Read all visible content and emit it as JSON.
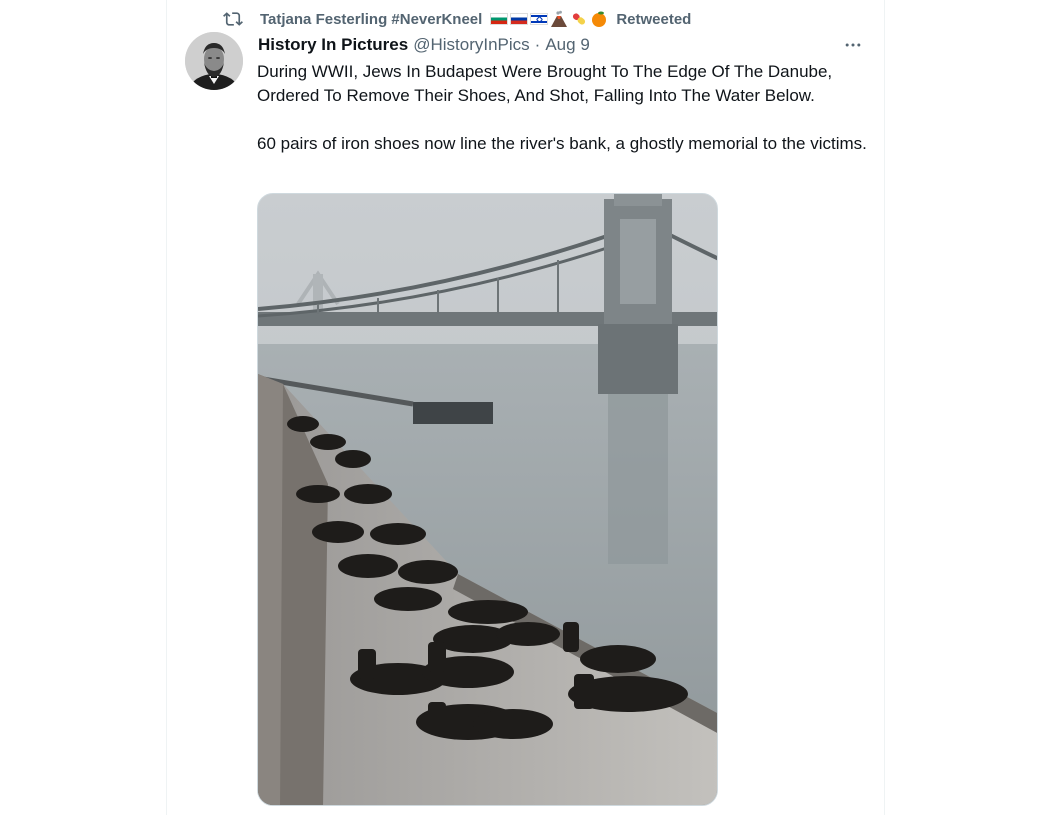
{
  "retweet": {
    "icon": "retweet-icon",
    "user": "Tatjana Festerling #NeverKneel",
    "flags": [
      "bulgaria-flag",
      "russia-flag",
      "israel-flag"
    ],
    "emojis": [
      "volcano-emoji",
      "pill-emoji",
      "orange-emoji"
    ],
    "label": "Retweeted"
  },
  "tweet": {
    "author_name": "History In Pictures",
    "handle": "@HistoryInPics",
    "separator": "·",
    "date": "Aug 9",
    "more_icon": "more-icon",
    "paragraph_1": "During WWII, Jews In Budapest Were Brought To The Edge Of The Danube, Ordered To Remove Their Shoes, And Shot, Falling Into The Water Below.",
    "paragraph_2": "60 pairs of iron shoes now line the river's bank, a ghostly memorial to the victims."
  }
}
